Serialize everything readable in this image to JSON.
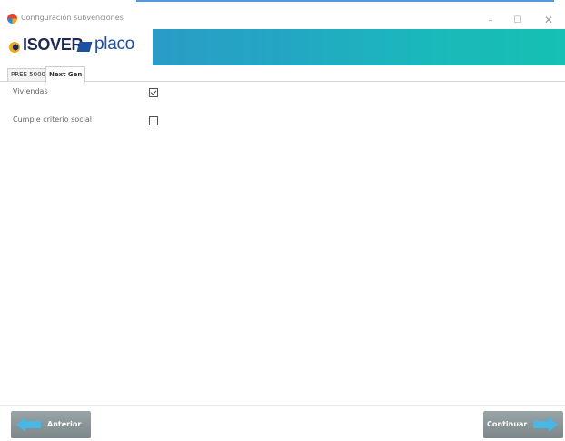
{
  "window": {
    "title": "Configuración subvenciones",
    "minimize_glyph": "–",
    "maximize_glyph": "☐",
    "close_glyph": "✕",
    "accent_color": "#2c7fd0"
  },
  "brand": {
    "logo_isover": "ISOVER",
    "logo_placo": "placo",
    "banner_colors": [
      "#2a9cc6",
      "#16c0b2"
    ]
  },
  "tabs": [
    {
      "label": "PREE 5000",
      "selected": false
    },
    {
      "label": "Next Gen",
      "selected": true
    }
  ],
  "options": [
    {
      "label": "Viviendas",
      "checked": true
    },
    {
      "label": "Cumple criterio social",
      "checked": false
    }
  ],
  "footer": {
    "prev_label": "Anterior",
    "next_label": "Continuar",
    "prev_icon": "arrow-left-icon",
    "next_icon": "arrow-right-icon",
    "button_color": "#8a9597",
    "arrow_color": "#49b7e6"
  }
}
